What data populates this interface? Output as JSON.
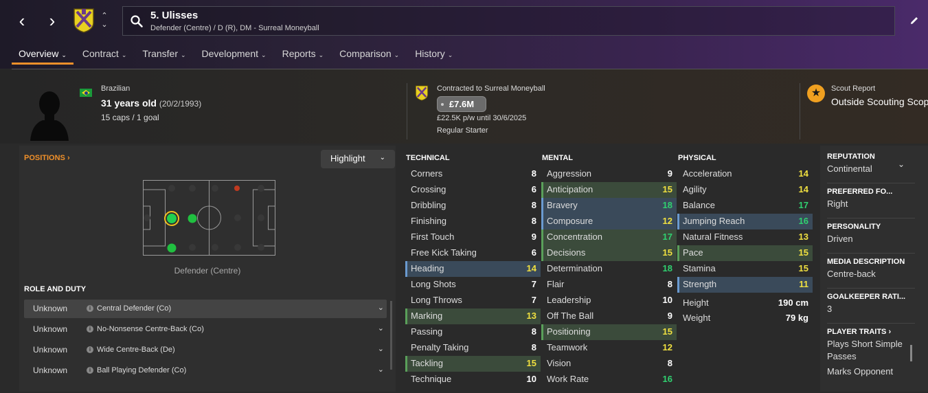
{
  "nav": {
    "back": "‹",
    "forward": "›"
  },
  "player": {
    "name": "5. Ulisses",
    "positions": "Defender (Centre) / D (R), DM - Surreal Moneyball"
  },
  "tabs": [
    {
      "label": "Overview"
    },
    {
      "label": "Contract"
    },
    {
      "label": "Transfer"
    },
    {
      "label": "Development"
    },
    {
      "label": "Reports"
    },
    {
      "label": "Comparison"
    },
    {
      "label": "History"
    }
  ],
  "profile": {
    "nationality": "Brazilian",
    "age": "31 years old",
    "dob": "(20/2/1993)",
    "caps": "15 caps / 1 goal"
  },
  "contract": {
    "label": "Contracted to Surreal Moneyball",
    "value": "£7.6M",
    "wage": "£22.5K p/w until 30/6/2025",
    "status": "Regular Starter"
  },
  "scout": {
    "label": "Scout Report",
    "value": "Outside Scouting Scope"
  },
  "positions_panel": {
    "title": "POSITIONS",
    "highlight": "Highlight",
    "caption": "Defender (Centre)",
    "role_title": "ROLE AND DUTY",
    "roles": [
      {
        "name": "Unknown",
        "duty": "Central Defender (Co)"
      },
      {
        "name": "Unknown",
        "duty": "No-Nonsense Centre-Back (Co)"
      },
      {
        "name": "Unknown",
        "duty": "Wide Centre-Back (De)"
      },
      {
        "name": "Unknown",
        "duty": "Ball Playing Defender (Co)"
      }
    ]
  },
  "attributes": {
    "technical": {
      "title": "TECHNICAL",
      "rows": [
        {
          "name": "Corners",
          "value": "8",
          "hl": ""
        },
        {
          "name": "Crossing",
          "value": "6",
          "hl": ""
        },
        {
          "name": "Dribbling",
          "value": "8",
          "hl": ""
        },
        {
          "name": "Finishing",
          "value": "8",
          "hl": ""
        },
        {
          "name": "First Touch",
          "value": "9",
          "hl": ""
        },
        {
          "name": "Free Kick Taking",
          "value": "6",
          "hl": ""
        },
        {
          "name": "Heading",
          "value": "14",
          "hl": "blue",
          "c": "y"
        },
        {
          "name": "Long Shots",
          "value": "7",
          "hl": ""
        },
        {
          "name": "Long Throws",
          "value": "7",
          "hl": ""
        },
        {
          "name": "Marking",
          "value": "13",
          "hl": "green",
          "c": "y"
        },
        {
          "name": "Passing",
          "value": "8",
          "hl": ""
        },
        {
          "name": "Penalty Taking",
          "value": "8",
          "hl": ""
        },
        {
          "name": "Tackling",
          "value": "15",
          "hl": "green",
          "c": "y"
        },
        {
          "name": "Technique",
          "value": "10",
          "hl": ""
        }
      ]
    },
    "mental": {
      "title": "MENTAL",
      "rows": [
        {
          "name": "Aggression",
          "value": "9",
          "hl": ""
        },
        {
          "name": "Anticipation",
          "value": "15",
          "hl": "green",
          "c": "y"
        },
        {
          "name": "Bravery",
          "value": "18",
          "hl": "blue",
          "c": "g"
        },
        {
          "name": "Composure",
          "value": "12",
          "hl": "blue",
          "c": "y"
        },
        {
          "name": "Concentration",
          "value": "17",
          "hl": "green",
          "c": "g"
        },
        {
          "name": "Decisions",
          "value": "15",
          "hl": "green",
          "c": "y"
        },
        {
          "name": "Determination",
          "value": "18",
          "hl": "",
          "c": "g"
        },
        {
          "name": "Flair",
          "value": "8",
          "hl": ""
        },
        {
          "name": "Leadership",
          "value": "10",
          "hl": ""
        },
        {
          "name": "Off The Ball",
          "value": "9",
          "hl": ""
        },
        {
          "name": "Positioning",
          "value": "15",
          "hl": "green",
          "c": "y"
        },
        {
          "name": "Teamwork",
          "value": "12",
          "hl": "",
          "c": "y"
        },
        {
          "name": "Vision",
          "value": "8",
          "hl": ""
        },
        {
          "name": "Work Rate",
          "value": "16",
          "hl": "",
          "c": "g"
        }
      ]
    },
    "physical": {
      "title": "PHYSICAL",
      "rows": [
        {
          "name": "Acceleration",
          "value": "14",
          "hl": "",
          "c": "y"
        },
        {
          "name": "Agility",
          "value": "14",
          "hl": "",
          "c": "y"
        },
        {
          "name": "Balance",
          "value": "17",
          "hl": "",
          "c": "g"
        },
        {
          "name": "Jumping Reach",
          "value": "16",
          "hl": "blue",
          "c": "g"
        },
        {
          "name": "Natural Fitness",
          "value": "13",
          "hl": "",
          "c": "y"
        },
        {
          "name": "Pace",
          "value": "15",
          "hl": "green",
          "c": "y"
        },
        {
          "name": "Stamina",
          "value": "15",
          "hl": "",
          "c": "y"
        },
        {
          "name": "Strength",
          "value": "11",
          "hl": "blue",
          "c": "y"
        }
      ],
      "height_label": "Height",
      "height": "190 cm",
      "weight_label": "Weight",
      "weight": "79 kg"
    }
  },
  "side": {
    "reputation_label": "REPUTATION",
    "reputation": "Continental",
    "foot_label": "PREFERRED FO...",
    "foot": "Right",
    "personality_label": "PERSONALITY",
    "personality": "Driven",
    "media_label": "MEDIA DESCRIPTION",
    "media": "Centre-back",
    "gk_label": "GOALKEEPER RATI...",
    "gk": "3",
    "traits_label": "PLAYER TRAITS",
    "trait1": "Plays Short Simple Passes",
    "trait2": "Marks Opponent"
  }
}
